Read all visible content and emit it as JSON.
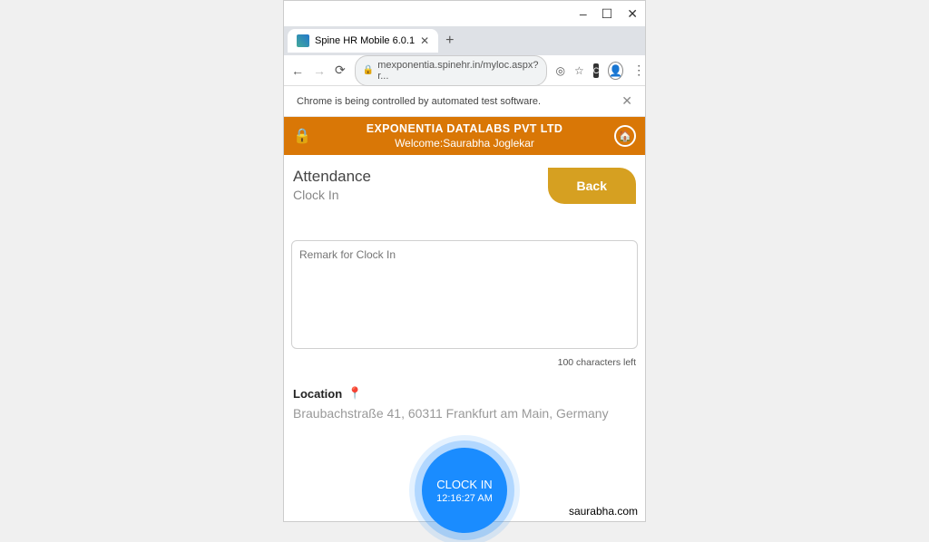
{
  "window": {
    "minimize": "–",
    "maximize": "☐",
    "close": "✕"
  },
  "tab": {
    "title": "Spine HR Mobile 6.0.1",
    "close": "✕",
    "new": "+"
  },
  "nav": {
    "back": "←",
    "forward": "→",
    "reload": "⟳",
    "url": "mexponentia.spinehr.in/myloc.aspx?r...",
    "menu": "⋮"
  },
  "infobar": {
    "text": "Chrome is being controlled by automated test software.",
    "close": "✕"
  },
  "header": {
    "company": "EXPONENTIA DATALABS PVT LTD",
    "welcome": "Welcome:Saurabha Joglekar"
  },
  "page": {
    "title": "Attendance",
    "subtitle": "Clock In",
    "back_button": "Back"
  },
  "remark": {
    "placeholder": "Remark for Clock In"
  },
  "char_counter": "100 characters left",
  "location": {
    "label": "Location",
    "value": "Braubachstraße 41, 60311 Frankfurt am Main, Germany"
  },
  "clock": {
    "label": "CLOCK IN",
    "time": "12:16:27 AM"
  },
  "watermark": "saurabha.com"
}
